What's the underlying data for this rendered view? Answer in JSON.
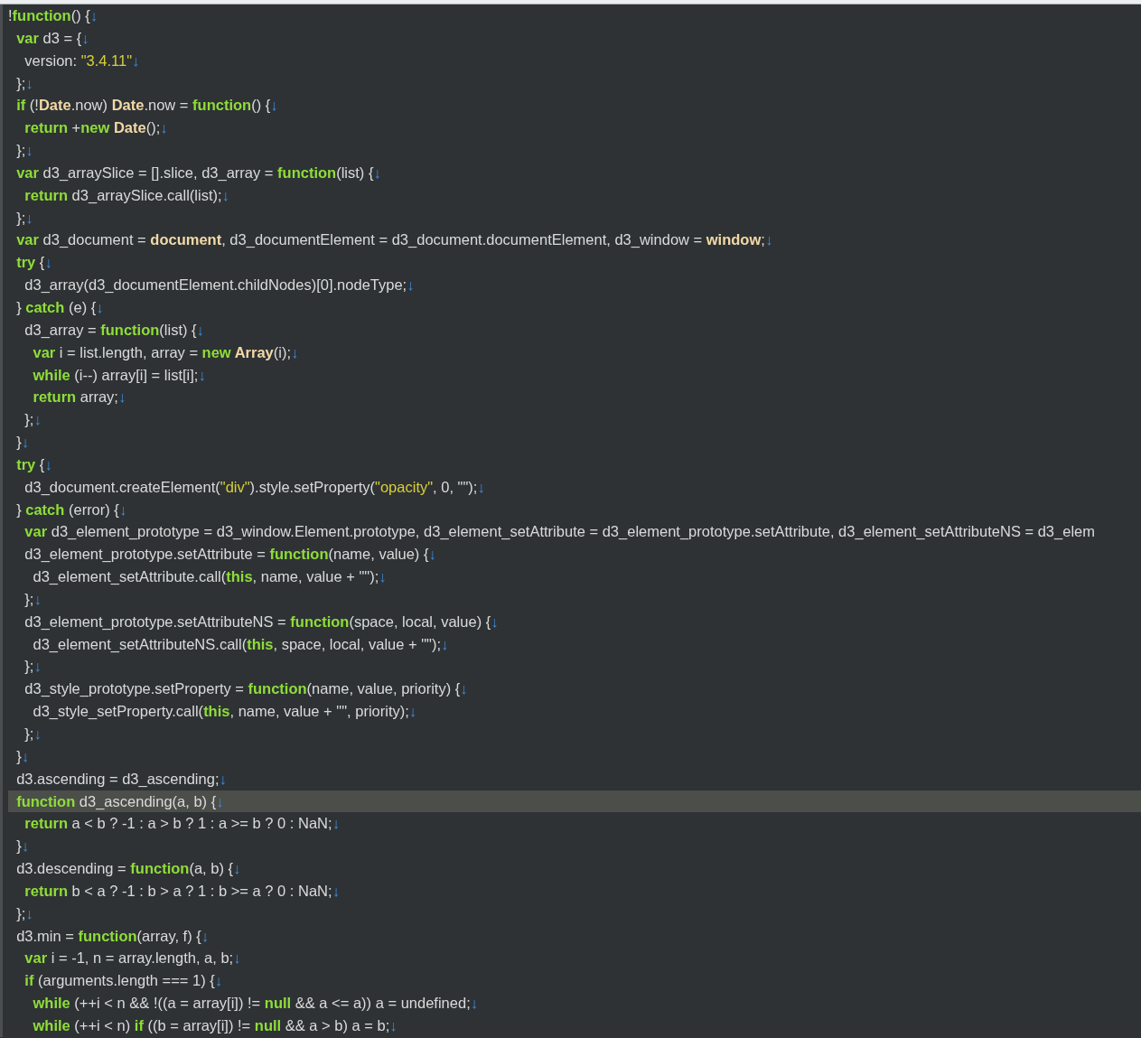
{
  "editor": {
    "lines": [
      {
        "current": false,
        "tokens": [
          {
            "kind": "plain",
            "text": "!"
          },
          {
            "kind": "keyword",
            "text": "function"
          },
          {
            "kind": "plain",
            "text": "() {"
          },
          {
            "kind": "eol",
            "text": "↓"
          }
        ]
      },
      {
        "current": false,
        "tokens": [
          {
            "kind": "keyword",
            "text": "  var"
          },
          {
            "kind": "plain",
            "text": " d3 = {"
          },
          {
            "kind": "eol",
            "text": "↓"
          }
        ]
      },
      {
        "current": false,
        "tokens": [
          {
            "kind": "plain",
            "text": "    version: "
          },
          {
            "kind": "string",
            "text": "\"3.4.11\""
          },
          {
            "kind": "eol",
            "text": "↓"
          }
        ]
      },
      {
        "current": false,
        "tokens": [
          {
            "kind": "plain",
            "text": "  };"
          },
          {
            "kind": "eol",
            "text": "↓"
          }
        ]
      },
      {
        "current": false,
        "tokens": [
          {
            "kind": "keyword",
            "text": "  if"
          },
          {
            "kind": "plain",
            "text": " (!"
          },
          {
            "kind": "builtin",
            "text": "Date"
          },
          {
            "kind": "plain",
            "text": ".now) "
          },
          {
            "kind": "builtin",
            "text": "Date"
          },
          {
            "kind": "plain",
            "text": ".now = "
          },
          {
            "kind": "keyword",
            "text": "function"
          },
          {
            "kind": "plain",
            "text": "() {"
          },
          {
            "kind": "eol",
            "text": "↓"
          }
        ]
      },
      {
        "current": false,
        "tokens": [
          {
            "kind": "keyword",
            "text": "    return"
          },
          {
            "kind": "plain",
            "text": " +"
          },
          {
            "kind": "keyword",
            "text": "new"
          },
          {
            "kind": "builtin",
            "text": " Date"
          },
          {
            "kind": "plain",
            "text": "();"
          },
          {
            "kind": "eol",
            "text": "↓"
          }
        ]
      },
      {
        "current": false,
        "tokens": [
          {
            "kind": "plain",
            "text": "  };"
          },
          {
            "kind": "eol",
            "text": "↓"
          }
        ]
      },
      {
        "current": false,
        "tokens": [
          {
            "kind": "keyword",
            "text": "  var"
          },
          {
            "kind": "plain",
            "text": " d3_arraySlice = [].slice, d3_array = "
          },
          {
            "kind": "keyword",
            "text": "function"
          },
          {
            "kind": "plain",
            "text": "(list) {"
          },
          {
            "kind": "eol",
            "text": "↓"
          }
        ]
      },
      {
        "current": false,
        "tokens": [
          {
            "kind": "keyword",
            "text": "    return"
          },
          {
            "kind": "plain",
            "text": " d3_arraySlice.call(list);"
          },
          {
            "kind": "eol",
            "text": "↓"
          }
        ]
      },
      {
        "current": false,
        "tokens": [
          {
            "kind": "plain",
            "text": "  };"
          },
          {
            "kind": "eol",
            "text": "↓"
          }
        ]
      },
      {
        "current": false,
        "tokens": [
          {
            "kind": "keyword",
            "text": "  var"
          },
          {
            "kind": "plain",
            "text": " d3_document = "
          },
          {
            "kind": "builtin",
            "text": "document"
          },
          {
            "kind": "plain",
            "text": ", d3_documentElement = d3_document.documentElement, d3_window = "
          },
          {
            "kind": "builtin",
            "text": "window"
          },
          {
            "kind": "plain",
            "text": ";"
          },
          {
            "kind": "eol",
            "text": "↓"
          }
        ]
      },
      {
        "current": false,
        "tokens": [
          {
            "kind": "keyword",
            "text": "  try"
          },
          {
            "kind": "plain",
            "text": " {"
          },
          {
            "kind": "eol",
            "text": "↓"
          }
        ]
      },
      {
        "current": false,
        "tokens": [
          {
            "kind": "plain",
            "text": "    d3_array(d3_documentElement.childNodes)[0].nodeType;"
          },
          {
            "kind": "eol",
            "text": "↓"
          }
        ]
      },
      {
        "current": false,
        "tokens": [
          {
            "kind": "plain",
            "text": "  } "
          },
          {
            "kind": "keyword",
            "text": "catch"
          },
          {
            "kind": "plain",
            "text": " (e) {"
          },
          {
            "kind": "eol",
            "text": "↓"
          }
        ]
      },
      {
        "current": false,
        "tokens": [
          {
            "kind": "plain",
            "text": "    d3_array = "
          },
          {
            "kind": "keyword",
            "text": "function"
          },
          {
            "kind": "plain",
            "text": "(list) {"
          },
          {
            "kind": "eol",
            "text": "↓"
          }
        ]
      },
      {
        "current": false,
        "tokens": [
          {
            "kind": "keyword",
            "text": "      var"
          },
          {
            "kind": "plain",
            "text": " i = list.length, array = "
          },
          {
            "kind": "keyword",
            "text": "new"
          },
          {
            "kind": "builtin",
            "text": " Array"
          },
          {
            "kind": "plain",
            "text": "(i);"
          },
          {
            "kind": "eol",
            "text": "↓"
          }
        ]
      },
      {
        "current": false,
        "tokens": [
          {
            "kind": "keyword",
            "text": "      while"
          },
          {
            "kind": "plain",
            "text": " (i--) array[i] = list[i];"
          },
          {
            "kind": "eol",
            "text": "↓"
          }
        ]
      },
      {
        "current": false,
        "tokens": [
          {
            "kind": "keyword",
            "text": "      return"
          },
          {
            "kind": "plain",
            "text": " array;"
          },
          {
            "kind": "eol",
            "text": "↓"
          }
        ]
      },
      {
        "current": false,
        "tokens": [
          {
            "kind": "plain",
            "text": "    };"
          },
          {
            "kind": "eol",
            "text": "↓"
          }
        ]
      },
      {
        "current": false,
        "tokens": [
          {
            "kind": "plain",
            "text": "  }"
          },
          {
            "kind": "eol",
            "text": "↓"
          }
        ]
      },
      {
        "current": false,
        "tokens": [
          {
            "kind": "keyword",
            "text": "  try"
          },
          {
            "kind": "plain",
            "text": " {"
          },
          {
            "kind": "eol",
            "text": "↓"
          }
        ]
      },
      {
        "current": false,
        "tokens": [
          {
            "kind": "plain",
            "text": "    d3_document.createElement("
          },
          {
            "kind": "string",
            "text": "\"div\""
          },
          {
            "kind": "plain",
            "text": ").style.setProperty("
          },
          {
            "kind": "string",
            "text": "\"opacity\""
          },
          {
            "kind": "plain",
            "text": ", 0, \"\");"
          },
          {
            "kind": "eol",
            "text": "↓"
          }
        ]
      },
      {
        "current": false,
        "tokens": [
          {
            "kind": "plain",
            "text": "  } "
          },
          {
            "kind": "keyword",
            "text": "catch"
          },
          {
            "kind": "plain",
            "text": " (error) {"
          },
          {
            "kind": "eol",
            "text": "↓"
          }
        ]
      },
      {
        "current": false,
        "tokens": [
          {
            "kind": "keyword",
            "text": "    var"
          },
          {
            "kind": "plain",
            "text": " d3_element_prototype = d3_window.Element.prototype, d3_element_setAttribute = d3_element_prototype.setAttribute, d3_element_setAttributeNS = d3_elem"
          }
        ]
      },
      {
        "current": false,
        "tokens": [
          {
            "kind": "plain",
            "text": "    d3_element_prototype.setAttribute = "
          },
          {
            "kind": "keyword",
            "text": "function"
          },
          {
            "kind": "plain",
            "text": "(name, value) {"
          },
          {
            "kind": "eol",
            "text": "↓"
          }
        ]
      },
      {
        "current": false,
        "tokens": [
          {
            "kind": "plain",
            "text": "      d3_element_setAttribute.call("
          },
          {
            "kind": "keyword",
            "text": "this"
          },
          {
            "kind": "plain",
            "text": ", name, value + \"\");"
          },
          {
            "kind": "eol",
            "text": "↓"
          }
        ]
      },
      {
        "current": false,
        "tokens": [
          {
            "kind": "plain",
            "text": "    };"
          },
          {
            "kind": "eol",
            "text": "↓"
          }
        ]
      },
      {
        "current": false,
        "tokens": [
          {
            "kind": "plain",
            "text": "    d3_element_prototype.setAttributeNS = "
          },
          {
            "kind": "keyword",
            "text": "function"
          },
          {
            "kind": "plain",
            "text": "(space, local, value) {"
          },
          {
            "kind": "eol",
            "text": "↓"
          }
        ]
      },
      {
        "current": false,
        "tokens": [
          {
            "kind": "plain",
            "text": "      d3_element_setAttributeNS.call("
          },
          {
            "kind": "keyword",
            "text": "this"
          },
          {
            "kind": "plain",
            "text": ", space, local, value + \"\");"
          },
          {
            "kind": "eol",
            "text": "↓"
          }
        ]
      },
      {
        "current": false,
        "tokens": [
          {
            "kind": "plain",
            "text": "    };"
          },
          {
            "kind": "eol",
            "text": "↓"
          }
        ]
      },
      {
        "current": false,
        "tokens": [
          {
            "kind": "plain",
            "text": "    d3_style_prototype.setProperty = "
          },
          {
            "kind": "keyword",
            "text": "function"
          },
          {
            "kind": "plain",
            "text": "(name, value, priority) {"
          },
          {
            "kind": "eol",
            "text": "↓"
          }
        ]
      },
      {
        "current": false,
        "tokens": [
          {
            "kind": "plain",
            "text": "      d3_style_setProperty.call("
          },
          {
            "kind": "keyword",
            "text": "this"
          },
          {
            "kind": "plain",
            "text": ", name, value + \"\", priority);"
          },
          {
            "kind": "eol",
            "text": "↓"
          }
        ]
      },
      {
        "current": false,
        "tokens": [
          {
            "kind": "plain",
            "text": "    };"
          },
          {
            "kind": "eol",
            "text": "↓"
          }
        ]
      },
      {
        "current": false,
        "tokens": [
          {
            "kind": "plain",
            "text": "  }"
          },
          {
            "kind": "eol",
            "text": "↓"
          }
        ]
      },
      {
        "current": false,
        "tokens": [
          {
            "kind": "plain",
            "text": "  d3.ascending = d3_ascending;"
          },
          {
            "kind": "eol",
            "text": "↓"
          }
        ]
      },
      {
        "current": true,
        "tokens": [
          {
            "kind": "keyword",
            "text": "  function"
          },
          {
            "kind": "plain",
            "text": " d3_ascending(a, b) {"
          },
          {
            "kind": "eol",
            "text": "↓"
          }
        ]
      },
      {
        "current": false,
        "tokens": [
          {
            "kind": "keyword",
            "text": "    return"
          },
          {
            "kind": "plain",
            "text": " a < b ? -1 : a > b ? 1 : a >= b ? 0 : NaN;"
          },
          {
            "kind": "eol",
            "text": "↓"
          }
        ]
      },
      {
        "current": false,
        "tokens": [
          {
            "kind": "plain",
            "text": "  }"
          },
          {
            "kind": "eol",
            "text": "↓"
          }
        ]
      },
      {
        "current": false,
        "tokens": [
          {
            "kind": "plain",
            "text": "  d3.descending = "
          },
          {
            "kind": "keyword",
            "text": "function"
          },
          {
            "kind": "plain",
            "text": "(a, b) {"
          },
          {
            "kind": "eol",
            "text": "↓"
          }
        ]
      },
      {
        "current": false,
        "tokens": [
          {
            "kind": "keyword",
            "text": "    return"
          },
          {
            "kind": "plain",
            "text": " b < a ? -1 : b > a ? 1 : b >= a ? 0 : NaN;"
          },
          {
            "kind": "eol",
            "text": "↓"
          }
        ]
      },
      {
        "current": false,
        "tokens": [
          {
            "kind": "plain",
            "text": "  };"
          },
          {
            "kind": "eol",
            "text": "↓"
          }
        ]
      },
      {
        "current": false,
        "tokens": [
          {
            "kind": "plain",
            "text": "  d3.min = "
          },
          {
            "kind": "keyword",
            "text": "function"
          },
          {
            "kind": "plain",
            "text": "(array, f) {"
          },
          {
            "kind": "eol",
            "text": "↓"
          }
        ]
      },
      {
        "current": false,
        "tokens": [
          {
            "kind": "keyword",
            "text": "    var"
          },
          {
            "kind": "plain",
            "text": " i = -1, n = array.length, a, b;"
          },
          {
            "kind": "eol",
            "text": "↓"
          }
        ]
      },
      {
        "current": false,
        "tokens": [
          {
            "kind": "keyword",
            "text": "    if"
          },
          {
            "kind": "plain",
            "text": " (arguments.length === 1) {"
          },
          {
            "kind": "eol",
            "text": "↓"
          }
        ]
      },
      {
        "current": false,
        "tokens": [
          {
            "kind": "keyword",
            "text": "      while"
          },
          {
            "kind": "plain",
            "text": " (++i < n && !((a = array[i]) != "
          },
          {
            "kind": "keyword",
            "text": "null"
          },
          {
            "kind": "plain",
            "text": " && a <= a)) a = undefined;"
          },
          {
            "kind": "eol",
            "text": "↓"
          }
        ]
      },
      {
        "current": false,
        "tokens": [
          {
            "kind": "keyword",
            "text": "      while"
          },
          {
            "kind": "plain",
            "text": " (++i < n) "
          },
          {
            "kind": "keyword",
            "text": "if"
          },
          {
            "kind": "plain",
            "text": " ((b = array[i]) != "
          },
          {
            "kind": "keyword",
            "text": "null"
          },
          {
            "kind": "plain",
            "text": " && a > b) a = b;"
          },
          {
            "kind": "eol",
            "text": "↓"
          }
        ]
      }
    ]
  }
}
